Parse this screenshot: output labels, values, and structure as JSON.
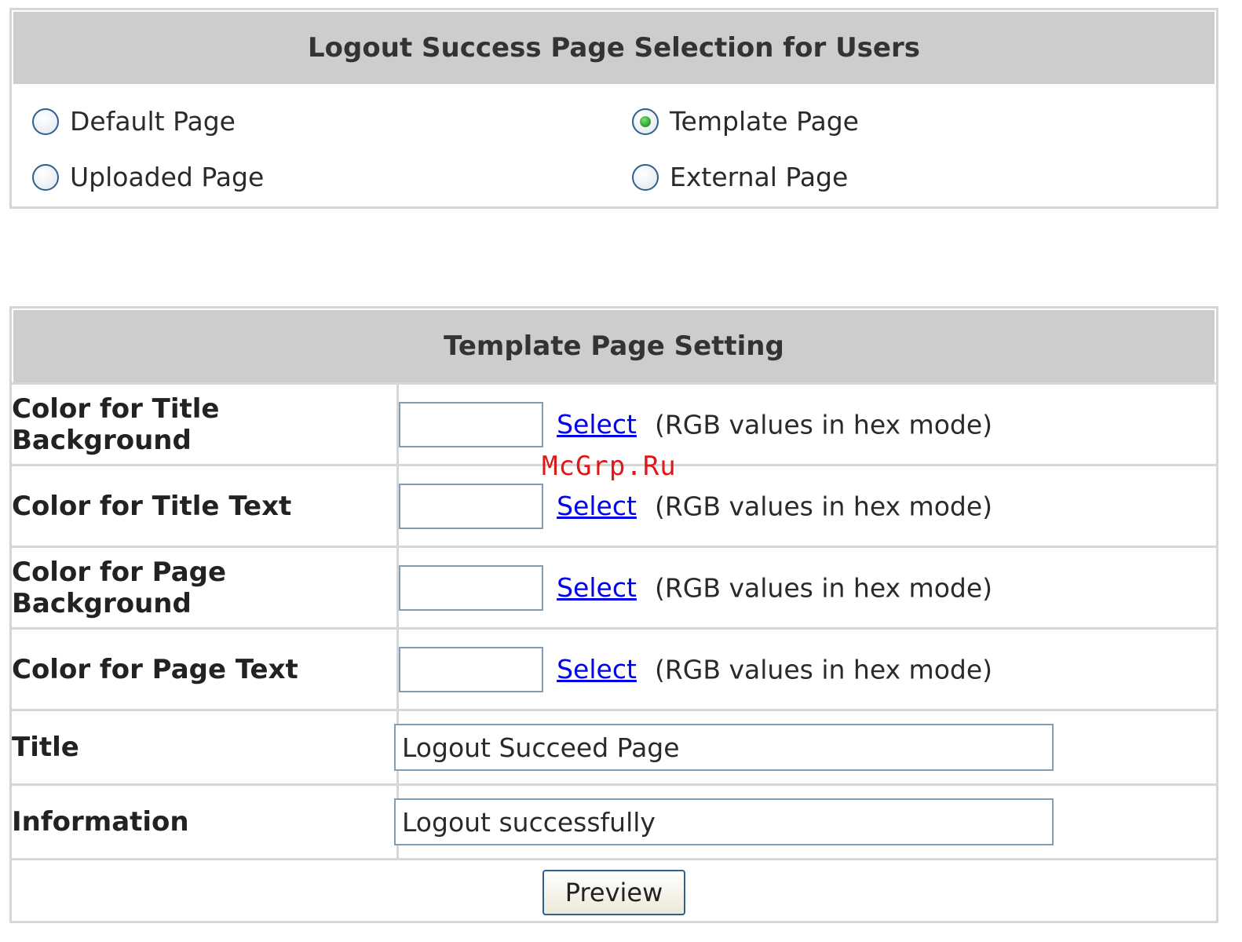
{
  "selection_panel": {
    "title": "Logout Success Page Selection for Users",
    "options": [
      {
        "label": "Default Page",
        "selected": false
      },
      {
        "label": "Template Page",
        "selected": true
      },
      {
        "label": "Uploaded Page",
        "selected": false
      },
      {
        "label": "External Page",
        "selected": false
      }
    ]
  },
  "template_panel": {
    "title": "Template Page Setting",
    "color_rows": [
      {
        "label": "Color for Title Background",
        "value": "",
        "link": "Select",
        "hint": "(RGB values in hex mode)"
      },
      {
        "label": "Color for Title Text",
        "value": "",
        "link": "Select",
        "hint": "(RGB values in hex mode)"
      },
      {
        "label": "Color for Page Background",
        "value": "",
        "link": "Select",
        "hint": "(RGB values in hex mode)"
      },
      {
        "label": "Color for Page Text",
        "value": "",
        "link": "Select",
        "hint": "(RGB values in hex mode)"
      }
    ],
    "title_row": {
      "label": "Title",
      "value": "Logout Succeed Page"
    },
    "info_row": {
      "label": "Information",
      "value": "Logout successfully"
    },
    "preview_label": "Preview"
  },
  "watermark": "McGrp.Ru",
  "colors": {
    "header_bg": "#cdcdcd",
    "border": "#d6d6d6",
    "link": "#0000ee",
    "watermark": "#e01818"
  }
}
